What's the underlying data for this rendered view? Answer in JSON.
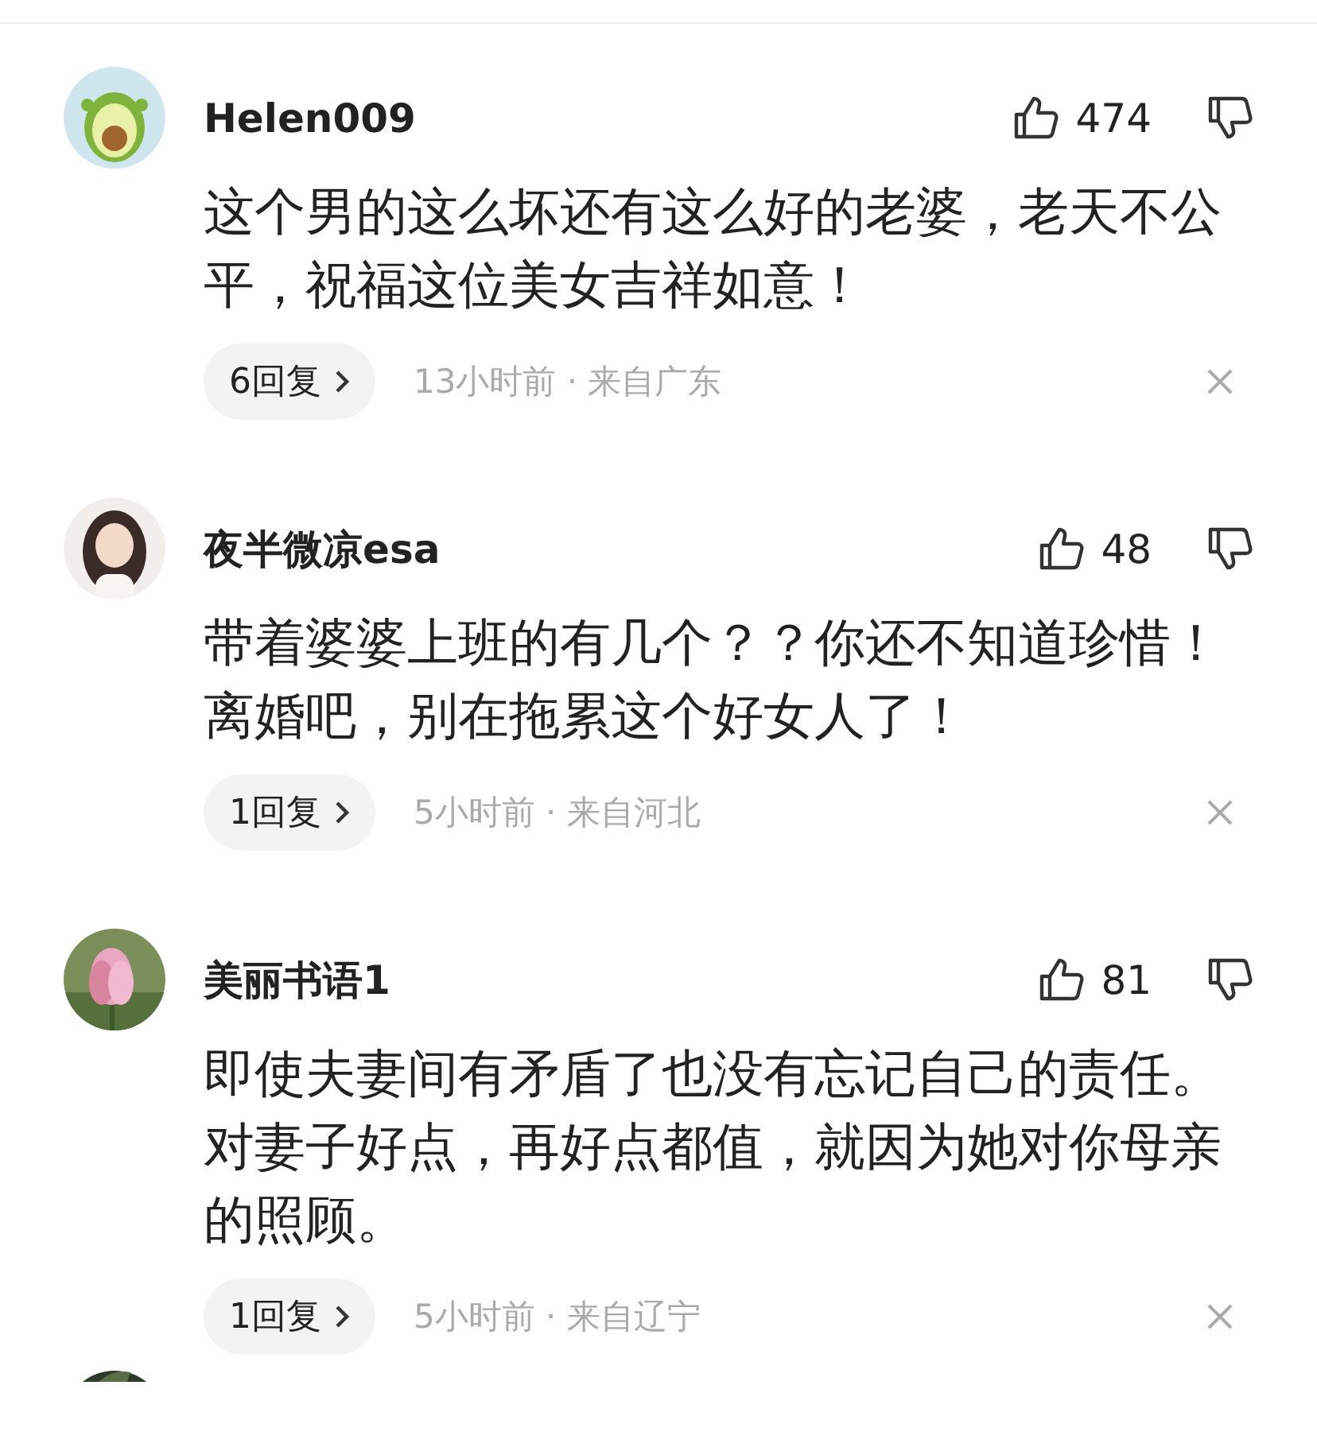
{
  "comments": [
    {
      "username": "Helen009",
      "likes": "474",
      "text": "这个男的这么坏还有这么好的老婆，老天不公平，祝福这位美女吉祥如意！",
      "replies": "6回复",
      "meta": "13小时前 · 来自广东"
    },
    {
      "username": "夜半微凉esa",
      "likes": "48",
      "text": "带着婆婆上班的有几个？？你还不知道珍惜！离婚吧，别在拖累这个好女人了！",
      "replies": "1回复",
      "meta": "5小时前 · 来自河北"
    },
    {
      "username": "美丽书语1",
      "likes": "81",
      "text": "即使夫妻间有矛盾了也没有忘记自己的责任。对妻子好点，再好点都值，就因为她对你母亲的照顾。",
      "replies": "1回复",
      "meta": "5小时前 · 来自辽宁"
    }
  ]
}
